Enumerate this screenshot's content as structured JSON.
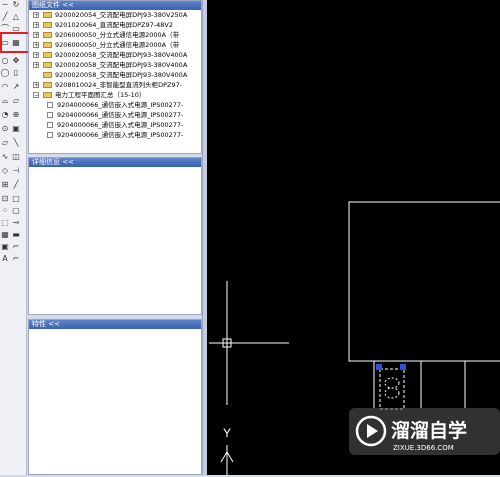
{
  "toolbar": {
    "tools": [
      {
        "left": "─",
        "right": "↻"
      },
      {
        "left": "╱",
        "right": "△"
      },
      {
        "left": "⌒",
        "right": "▭"
      },
      {
        "left": "▭",
        "right": "▦"
      },
      {
        "left": "○",
        "right": "✥"
      },
      {
        "left": "◯",
        "right": "▯"
      },
      {
        "left": "◠",
        "right": "↗"
      },
      {
        "left": "⌓",
        "right": "▱"
      },
      {
        "left": "◔",
        "right": "⊕"
      },
      {
        "left": "⊙",
        "right": "▣"
      },
      {
        "left": "▱",
        "right": "╲"
      },
      {
        "left": "∿",
        "right": "◫"
      },
      {
        "left": "◇",
        "right": "⊣"
      },
      {
        "left": "⊞",
        "right": "╱"
      },
      {
        "left": "⊡",
        "right": "▢"
      },
      {
        "left": "⁘",
        "right": "▢"
      },
      {
        "left": "⬚",
        "right": "⊸"
      },
      {
        "left": "▦",
        "right": "▬"
      },
      {
        "left": "▣",
        "right": "⌐"
      },
      {
        "left": "A",
        "right": "⌐"
      }
    ]
  },
  "file_panel": {
    "title": "图纸文件 <<",
    "items": [
      "9200020054_交流配电屏DPJ93-380V250A",
      "9201020064_直流配电屏DPZ97-48V2",
      "9206000050_分立式通信电源2000A（带",
      "9206000050_分立式通信电源2000A（带",
      "9200020058_交流配电屏DPJ93-380V400A",
      "9200020058_交流配电屏DPJ93-380V400A",
      "9200020058_交流配电屏DPJ93-380V400A",
      "9208010024_非智能型直流列头柜DPZ97-",
      "电力工程平面图汇总（15-10）",
      "9204000066_通信嵌入式电源_IPS00277-",
      "9204000066_通信嵌入式电源_IPS00277-",
      "9204000066_通信嵌入式电源_IPS00277-",
      "9204000066_通信嵌入式电源_IPS00277-"
    ]
  },
  "detail_panel": {
    "title": "详细信息 <<"
  },
  "property_panel": {
    "title": "特性 <<"
  },
  "cad": {
    "ucs_y_label": "Y"
  },
  "watermark": {
    "cn": "溜溜自学",
    "en": "ZIXUE.3D66.COM"
  }
}
